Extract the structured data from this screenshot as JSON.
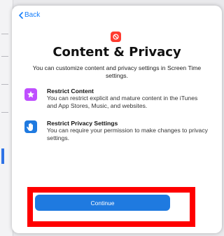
{
  "nav": {
    "back_label": "Back"
  },
  "header": {
    "icon": "content-restriction-icon",
    "title": "Content & Privacy",
    "subtitle": "You can customize content and privacy settings in Screen Time settings."
  },
  "features": [
    {
      "icon": "star-icon",
      "title": "Restrict Content",
      "description": "You can restrict explicit and mature content in the iTunes and App Stores, Music, and websites."
    },
    {
      "icon": "hand-icon",
      "title": "Restrict Privacy Settings",
      "description": "You can require your permission to make changes to privacy settings."
    }
  ],
  "actions": {
    "continue_label": "Continue"
  },
  "colors": {
    "accent": "#147efb",
    "button": "#1f7ae0",
    "star_icon_bg": "#bf4fff",
    "hand_icon_bg": "#1f7ae0",
    "header_icon_bg": "#ff3b30",
    "highlight": "#ff0000"
  }
}
